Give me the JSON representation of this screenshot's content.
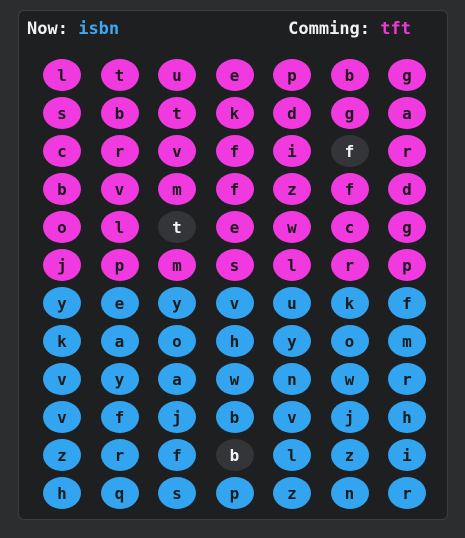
{
  "header": {
    "now_label": "Now:",
    "now_value": "isbn",
    "coming_label": "Comming:",
    "coming_value": "tft"
  },
  "colors": {
    "pink": "#f03ae0",
    "blue": "#32a4f0",
    "dark": "#333538",
    "background": "#1d1f21"
  },
  "grid": {
    "rows": [
      {
        "letters": [
          "l",
          "t",
          "u",
          "e",
          "p",
          "b",
          "g"
        ],
        "colors": [
          "pink",
          "pink",
          "pink",
          "pink",
          "pink",
          "pink",
          "pink"
        ]
      },
      {
        "letters": [
          "s",
          "b",
          "t",
          "k",
          "d",
          "g",
          "a"
        ],
        "colors": [
          "pink",
          "pink",
          "pink",
          "pink",
          "pink",
          "pink",
          "pink"
        ]
      },
      {
        "letters": [
          "c",
          "r",
          "v",
          "f",
          "i",
          "f",
          "r"
        ],
        "colors": [
          "pink",
          "pink",
          "pink",
          "pink",
          "pink",
          "dark",
          "pink"
        ]
      },
      {
        "letters": [
          "b",
          "v",
          "m",
          "f",
          "z",
          "f",
          "d"
        ],
        "colors": [
          "pink",
          "pink",
          "pink",
          "pink",
          "pink",
          "pink",
          "pink"
        ]
      },
      {
        "letters": [
          "o",
          "l",
          "t",
          "e",
          "w",
          "c",
          "g"
        ],
        "colors": [
          "pink",
          "pink",
          "dark",
          "pink",
          "pink",
          "pink",
          "pink"
        ]
      },
      {
        "letters": [
          "j",
          "p",
          "m",
          "s",
          "l",
          "r",
          "p"
        ],
        "colors": [
          "pink",
          "pink",
          "pink",
          "pink",
          "pink",
          "pink",
          "pink"
        ]
      },
      {
        "letters": [
          "y",
          "e",
          "y",
          "v",
          "u",
          "k",
          "f"
        ],
        "colors": [
          "blue",
          "blue",
          "blue",
          "blue",
          "blue",
          "blue",
          "blue"
        ]
      },
      {
        "letters": [
          "k",
          "a",
          "o",
          "h",
          "y",
          "o",
          "m"
        ],
        "colors": [
          "blue",
          "blue",
          "blue",
          "blue",
          "blue",
          "blue",
          "blue"
        ]
      },
      {
        "letters": [
          "v",
          "y",
          "a",
          "w",
          "n",
          "w",
          "r"
        ],
        "colors": [
          "blue",
          "blue",
          "blue",
          "blue",
          "blue",
          "blue",
          "blue"
        ]
      },
      {
        "letters": [
          "v",
          "f",
          "j",
          "b",
          "v",
          "j",
          "h"
        ],
        "colors": [
          "blue",
          "blue",
          "blue",
          "blue",
          "blue",
          "blue",
          "blue"
        ]
      },
      {
        "letters": [
          "z",
          "r",
          "f",
          "b",
          "l",
          "z",
          "i"
        ],
        "colors": [
          "blue",
          "blue",
          "blue",
          "dark",
          "blue",
          "blue",
          "blue"
        ]
      },
      {
        "letters": [
          "h",
          "q",
          "s",
          "p",
          "z",
          "n",
          "r"
        ],
        "colors": [
          "blue",
          "blue",
          "blue",
          "blue",
          "blue",
          "blue",
          "blue"
        ]
      }
    ]
  }
}
